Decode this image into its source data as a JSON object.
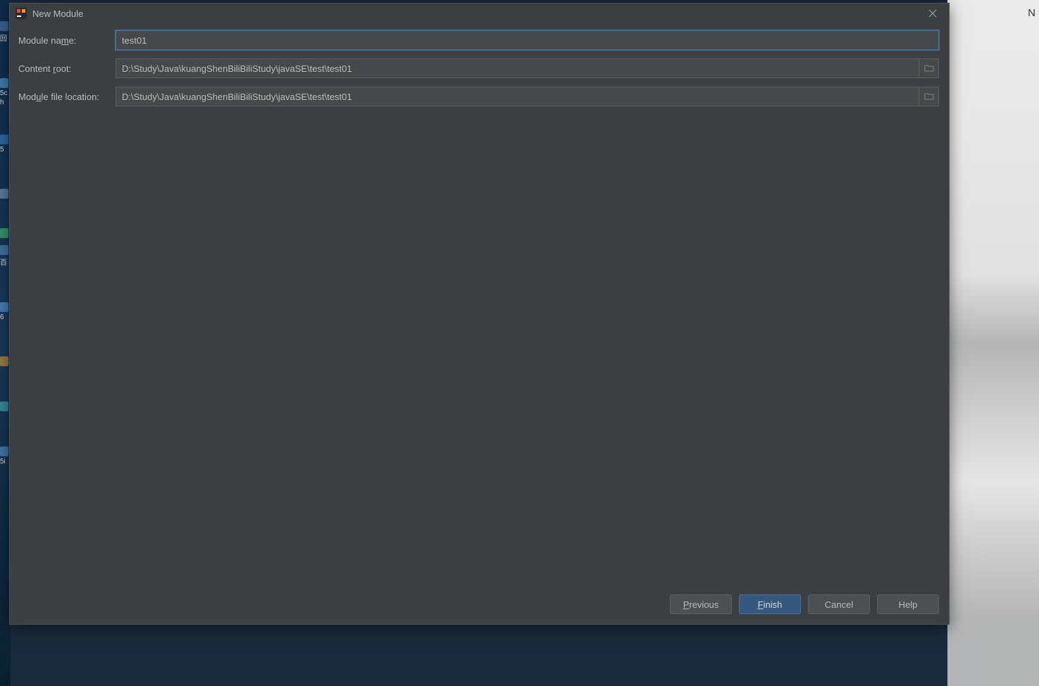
{
  "dialog": {
    "title": "New Module",
    "fields": {
      "module_name": {
        "label_pre": "Module na",
        "label_u": "m",
        "label_post": "e:",
        "value": "test01"
      },
      "content_root": {
        "label_pre": "Content ",
        "label_u": "r",
        "label_post": "oot:",
        "value": "D:\\Study\\Java\\kuangShenBiliBiliStudy\\javaSE\\test\\test01"
      },
      "module_file_location": {
        "label_pre": "Mod",
        "label_u": "u",
        "label_post": "le file location:",
        "value": "D:\\Study\\Java\\kuangShenBiliBiliStudy\\javaSE\\test\\test01"
      }
    },
    "buttons": {
      "previous_u": "P",
      "previous_rest": "revious",
      "finish_u": "F",
      "finish_rest": "inish",
      "cancel": "Cancel",
      "help": "Help"
    }
  },
  "background": {
    "right_char": "N",
    "desk_labels": [
      "回",
      "5c",
      "h",
      "5",
      "",
      "百",
      "6",
      "",
      "5i"
    ]
  }
}
